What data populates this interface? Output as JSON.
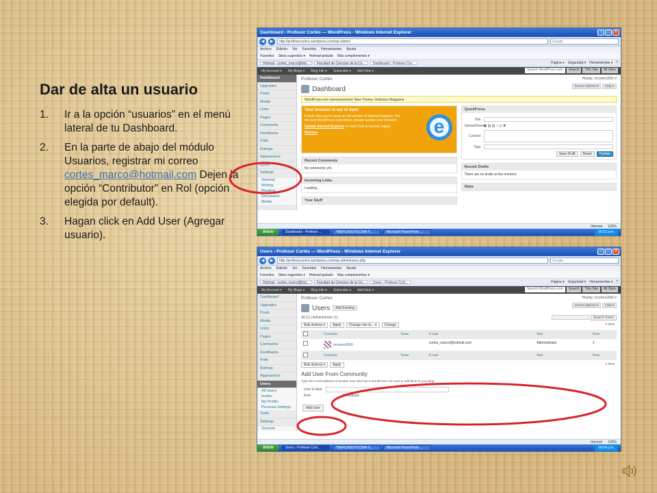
{
  "slide": {
    "title": "Dar de alta un usuario",
    "steps": [
      {
        "num": "1.",
        "text": "Ir a la opción “usuarios” en el menú lateral de tu Dashboard."
      },
      {
        "num": "2.",
        "text_before": "En la parte de abajo del módulo Usuarios, registrar mi correo ",
        "email": "cortes_marco@hotmail.com",
        "text_after": " Dejen la opción “Contributor” en Rol (opción elegida por default)."
      },
      {
        "num": "3.",
        "text": "Hagan click en Add User (Agregar usuario)."
      }
    ]
  },
  "colors": {
    "annotation": "#d8232a",
    "wp_admin_bar": "#464646",
    "ie_titlebar": "#1b4fb4",
    "ie_notice": "#f0a30a"
  },
  "shot1": {
    "window_title": "Dashboard › Profesor Cortés — WordPress - Windows Internet Explorer",
    "url": "http://profesorcortes.wordpress.com/wp-admin/",
    "search_placeholder": "Google",
    "menu": [
      "Archivo",
      "Edición",
      "Ver",
      "Favoritos",
      "Herramientas",
      "Ayuda"
    ],
    "favorites": [
      "Favoritos",
      "Sitios sugeridos ▾",
      "Hotmail gratuito",
      "Más complementos ▾"
    ],
    "tabs": [
      "Hotmail - cortes_marco@hot...",
      "Facultad de Ciencias de la Co...",
      "Dashboard › Profesor Cor..."
    ],
    "tab_tools": [
      "Página ▾",
      "Seguridad ▾",
      "Herramientas ▾",
      "?"
    ],
    "wp_bar": [
      "My Account ▾",
      "My Blogs ▾",
      "Blog Info ▾",
      "Subscribe ▾",
      "Add New ▾"
    ],
    "wp_search": {
      "placeholder": "Search WordPress.com",
      "button1": "Search",
      "button2": "This Site",
      "button3": "All Sites"
    },
    "sidebar": [
      "Dashboard",
      "Upgrades",
      "Posts",
      "Media",
      "Links",
      "Pages",
      "Comments",
      "Feedbacks",
      "Polls",
      "Ratings",
      "Appearance",
      "Users",
      "Settings",
      "General",
      "Writing",
      "Reading",
      "Discussion",
      "Media"
    ],
    "blog_name": "Profesor Cortés",
    "howdy": "Howdy, mcortes2000 ▾",
    "page_title": "Dashboard",
    "screen_options": "Screen Options ▾",
    "help": "Help ▾",
    "notice": "WordPress.com announcement: New Theme: Delicious Magazine",
    "ie_box": {
      "title": "Your browser is out of date!",
      "text": "It looks like you're using an old version of Internet Explorer. For the best WordPress experience, please update your browser.",
      "link": "Update Internet Explorer",
      "link_after": " or learn how to browse happy",
      "dismiss": "Dismiss"
    },
    "recent_comments": {
      "title": "Recent Comments",
      "body": "No comments yet."
    },
    "incoming_links": {
      "title": "Incoming Links",
      "body": "Loading..."
    },
    "your_stuff": {
      "title": "Your Stuff"
    },
    "quickpress": {
      "title": "QuickPress",
      "title_label": "Title",
      "upload_label": "Upload/Insert",
      "content_label": "Content",
      "tags_label": "Tags",
      "save_draft": "Save Draft",
      "reset": "Reset",
      "publish": "Publish"
    },
    "recent_drafts": {
      "title": "Recent Drafts",
      "body": "There are no drafts at the moment"
    },
    "stats": {
      "title": "Stats"
    },
    "status": {
      "internet": "Internet",
      "zoom": "100%"
    },
    "taskbar": {
      "start": "Inicio",
      "tasks": [
        "Dashboard › Profesor ...",
        "*MERCADOTECNIA Y...",
        "Microsoft PowerPoint ..."
      ],
      "clock": "05:52 p.m."
    }
  },
  "shot2": {
    "window_title": "Users › Profesor Cortés — WordPress - Windows Internet Explorer",
    "url": "http://profesorcortes.wordpress.com/wp-admin/users.php",
    "search_placeholder": "Google",
    "menu": [
      "Archivo",
      "Edición",
      "Ver",
      "Favoritos",
      "Herramientas",
      "Ayuda"
    ],
    "favorites": [
      "Favoritos",
      "Sitios sugeridos ▾",
      "Hotmail gratuito",
      "Más complementos ▾"
    ],
    "tabs": [
      "Hotmail - cortes_marco@hot...",
      "Facultad de Ciencias de la Co...",
      "Users › Profesor Cort..."
    ],
    "tab_tools": [
      "Página ▾",
      "Seguridad ▾",
      "Herramientas ▾",
      "?"
    ],
    "wp_bar": [
      "My Account ▾",
      "My Blogs ▾",
      "Blog Info ▾",
      "Subscribe ▾",
      "Add New ▾"
    ],
    "wp_search": {
      "placeholder": "Search WordPress.com",
      "button1": "Search",
      "button2": "This Site",
      "button3": "All Sites"
    },
    "sidebar": [
      "Dashboard",
      "Upgrades",
      "Posts",
      "Media",
      "Links",
      "Pages",
      "Comments",
      "Feedbacks",
      "Polls",
      "Ratings",
      "Appearance",
      "Users",
      "All Users",
      "Invites",
      "My Profile",
      "Personal Settings",
      "Tools",
      "Settings",
      "General"
    ],
    "blog_name": "Profesor Cortes",
    "howdy": "Howdy, mcortes2000 ▾",
    "page_title": "Users",
    "add_existing": "Add Existing",
    "screen_options": "Screen Options ▾",
    "help": "Help ▾",
    "filter_all": "All (1) | Administrator (1)",
    "search_users": "Search Users",
    "bulk_actions": "Bulk Actions ▾",
    "apply": "Apply",
    "change_role": "Change role to... ▾",
    "change": "Change",
    "item_count": "1 item",
    "columns": [
      "Username",
      "Name",
      "E-mail",
      "Role",
      "Posts"
    ],
    "rows": [
      {
        "username": "mcortes2000",
        "name": "",
        "email": "cortes_marco@hotmail.com",
        "role": "Administrator",
        "posts": "2"
      }
    ],
    "add_heading": "Add User From Community",
    "add_text": "Type the e-mail address of another user who has a WordPress.com user to add them to your blog.",
    "email_label": "User E-Mail",
    "role_label": "Role",
    "role_value": "Contributor",
    "add_user": "Add User",
    "status": {
      "internet": "Internet",
      "zoom": "100%"
    },
    "taskbar": {
      "start": "Inicio",
      "tasks": [
        "Users › Profesor Cort...",
        "*MERCADOTECNIA Y...",
        "Microsoft PowerPoint ..."
      ],
      "clock": "06:04 p.m."
    }
  }
}
